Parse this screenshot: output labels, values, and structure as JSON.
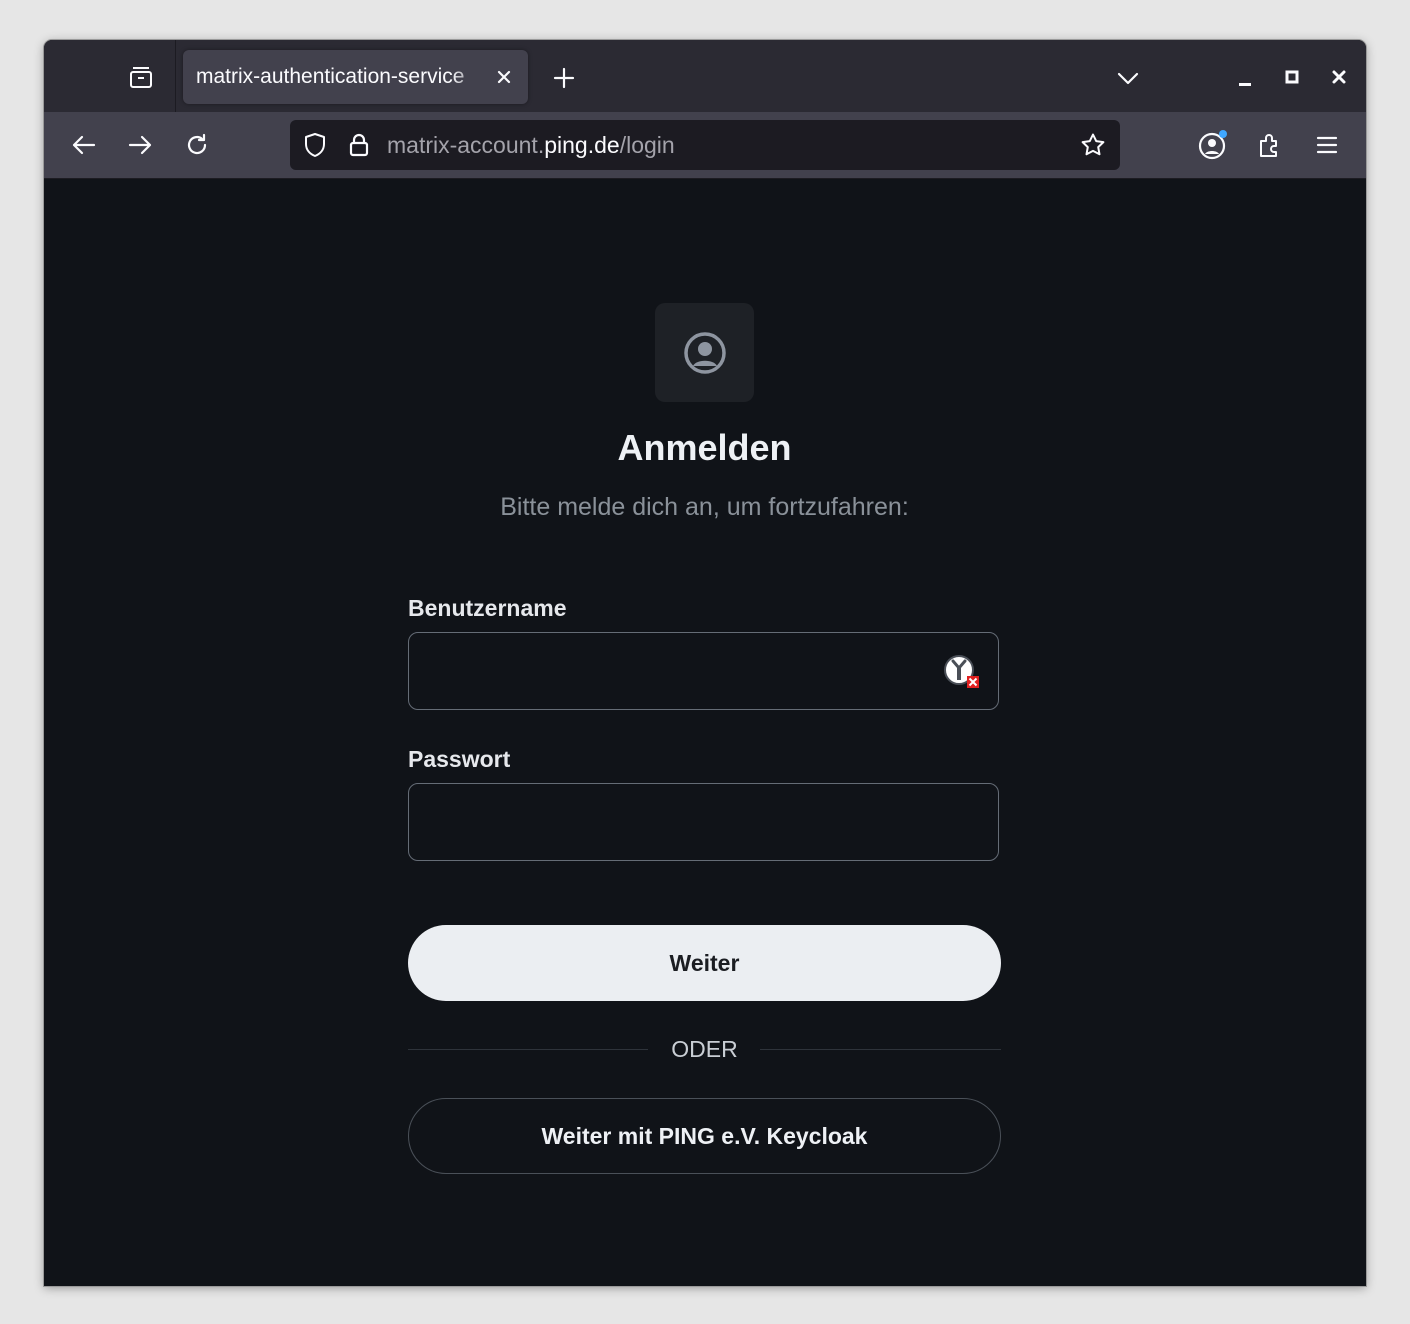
{
  "browser": {
    "tab_title": "matrix-authentication-service",
    "url": {
      "prefix": "matrix-account.",
      "host": "ping.de",
      "path": "/login"
    },
    "icons": {
      "tab_overview": "tab-overview-icon",
      "new_tab": "plus-icon",
      "list_tabs": "chevron-down-icon",
      "minimize": "minimize-icon",
      "maximize": "maximize-icon",
      "close_window": "close-icon",
      "back": "arrow-left-icon",
      "forward": "arrow-right-icon",
      "reload": "reload-icon",
      "tracking_protection": "shield-icon",
      "secure": "lock-icon",
      "bookmark": "star-icon",
      "account": "account-icon",
      "extensions": "puzzle-icon",
      "menu": "hamburger-menu-icon"
    }
  },
  "login": {
    "title": "Anmelden",
    "subtitle": "Bitte melde dich an, um fortzufahren:",
    "username_label": "Benutzername",
    "username_value": "",
    "password_label": "Passwort",
    "password_value": "",
    "submit_label": "Weiter",
    "divider_label": "ODER",
    "sso_label": "Weiter mit PING e.V. Keycloak"
  },
  "colors": {
    "page_bg": "#101318",
    "button_bg": "#ebeef2",
    "accent_dot": "#3fa7ff",
    "keepass_x": "#e02020"
  }
}
